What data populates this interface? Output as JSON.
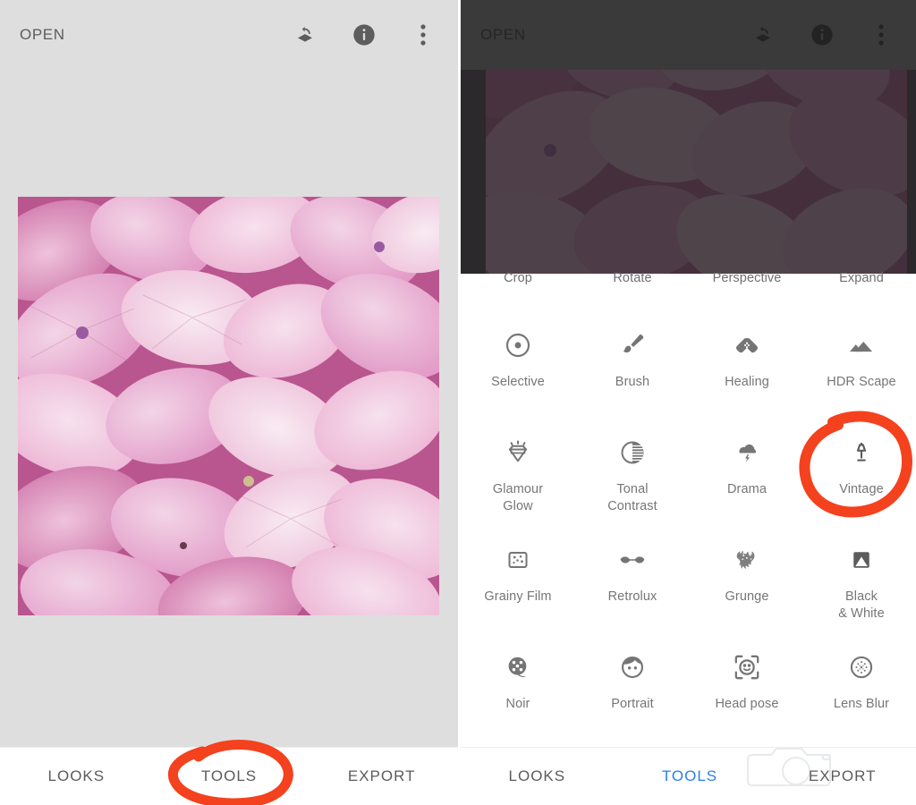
{
  "app": {
    "accent_blue": "#2b7de9",
    "marker_red": "#f4411e",
    "left_bg": "#dedede",
    "dark_overlay": "#3a3a3a"
  },
  "left_panel": {
    "appbar": {
      "open_label": "OPEN",
      "actions": [
        {
          "name": "undo-layers-icon",
          "label": "Undo"
        },
        {
          "name": "info-icon",
          "label": "Info"
        },
        {
          "name": "overflow-menu-icon",
          "label": "More options"
        }
      ]
    },
    "photo": {
      "alt": "Pink hydrangea petals close-up"
    },
    "bottom_nav": [
      {
        "label": "LOOKS",
        "active": false
      },
      {
        "label": "TOOLS",
        "active": false
      },
      {
        "label": "EXPORT",
        "active": false
      }
    ],
    "annotation": {
      "target": "TOOLS",
      "shape": "hand-drawn-circle"
    }
  },
  "right_panel": {
    "appbar": {
      "open_label": "OPEN",
      "actions": [
        {
          "name": "undo-layers-icon",
          "label": "Undo"
        },
        {
          "name": "info-icon",
          "label": "Info"
        },
        {
          "name": "overflow-menu-icon",
          "label": "More options"
        }
      ]
    },
    "clipped_row": [
      {
        "label": "Crop"
      },
      {
        "label": "Rotate"
      },
      {
        "label": "Perspective"
      },
      {
        "label": "Expand"
      }
    ],
    "tools": [
      {
        "label": "Selective",
        "icon": "selective-icon"
      },
      {
        "label": "Brush",
        "icon": "brush-icon"
      },
      {
        "label": "Healing",
        "icon": "healing-icon"
      },
      {
        "label": "HDR Scape",
        "icon": "hdr-scape-icon"
      },
      {
        "label": "Glamour\nGlow",
        "icon": "glamour-glow-icon"
      },
      {
        "label": "Tonal\nContrast",
        "icon": "tonal-contrast-icon"
      },
      {
        "label": "Drama",
        "icon": "drama-icon"
      },
      {
        "label": "Vintage",
        "icon": "vintage-lamp-icon"
      },
      {
        "label": "Grainy Film",
        "icon": "grainy-film-icon"
      },
      {
        "label": "Retrolux",
        "icon": "retrolux-icon"
      },
      {
        "label": "Grunge",
        "icon": "grunge-icon"
      },
      {
        "label": "Black\n& White",
        "icon": "black-and-white-icon"
      },
      {
        "label": "Noir",
        "icon": "noir-icon"
      },
      {
        "label": "Portrait",
        "icon": "portrait-icon"
      },
      {
        "label": "Head pose",
        "icon": "head-pose-icon"
      },
      {
        "label": "Lens Blur",
        "icon": "lens-blur-icon"
      }
    ],
    "bottom_nav": [
      {
        "label": "LOOKS",
        "active": false
      },
      {
        "label": "TOOLS",
        "active": true
      },
      {
        "label": "EXPORT",
        "active": false
      }
    ],
    "annotation": {
      "target": "Vintage",
      "shape": "hand-drawn-circle"
    },
    "watermark": {
      "name": "camera-watermark-icon"
    }
  }
}
